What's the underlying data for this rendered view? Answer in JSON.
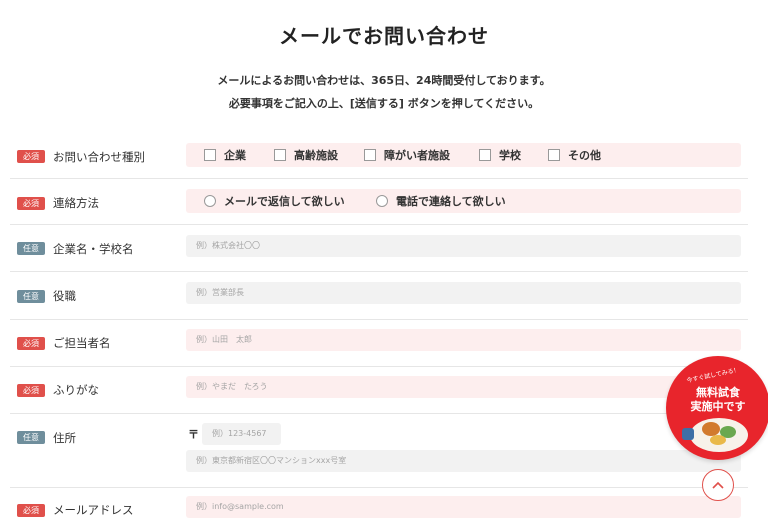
{
  "page_title": "メールでお問い合わせ",
  "intro": {
    "line1": "メールによるお問い合わせは、365日、24時間受付しております。",
    "line2": "必要事項をご記入の上、[送信する] ボタンを押してください。"
  },
  "badges": {
    "required": "必須",
    "optional": "任意"
  },
  "inquiry_type": {
    "label": "お問い合わせ種別",
    "options": [
      "企業",
      "高齢施設",
      "障がい者施設",
      "学校",
      "その他"
    ]
  },
  "contact_method": {
    "label": "連絡方法",
    "options": [
      "メールで返信して欲しい",
      "電話で連絡して欲しい"
    ]
  },
  "company": {
    "label": "企業名・学校名",
    "placeholder": "例）株式会社〇〇"
  },
  "position": {
    "label": "役職",
    "placeholder": "例）営業部長"
  },
  "person": {
    "label": "ご担当者名",
    "placeholder": "例）山田　太郎"
  },
  "furigana": {
    "label": "ふりがな",
    "placeholder": "例）やまだ　たろう"
  },
  "address": {
    "label": "住所",
    "postal_mark": "〒",
    "postal_placeholder": "例）123-4567",
    "address_placeholder": "例）東京都新宿区〇〇マンションxxx号室"
  },
  "email": {
    "label": "メールアドレス",
    "placeholder": "例）info@sample.com"
  },
  "promo": {
    "small_text": "今すぐ試してみる！",
    "line1": "無料試食",
    "line2": "実施中です"
  },
  "colors": {
    "required_badge": "#e0504b",
    "optional_badge": "#6f8e9c",
    "pink_field": "#fdeeee",
    "grey_field": "#f2f2f2",
    "promo": "#e8252c"
  }
}
